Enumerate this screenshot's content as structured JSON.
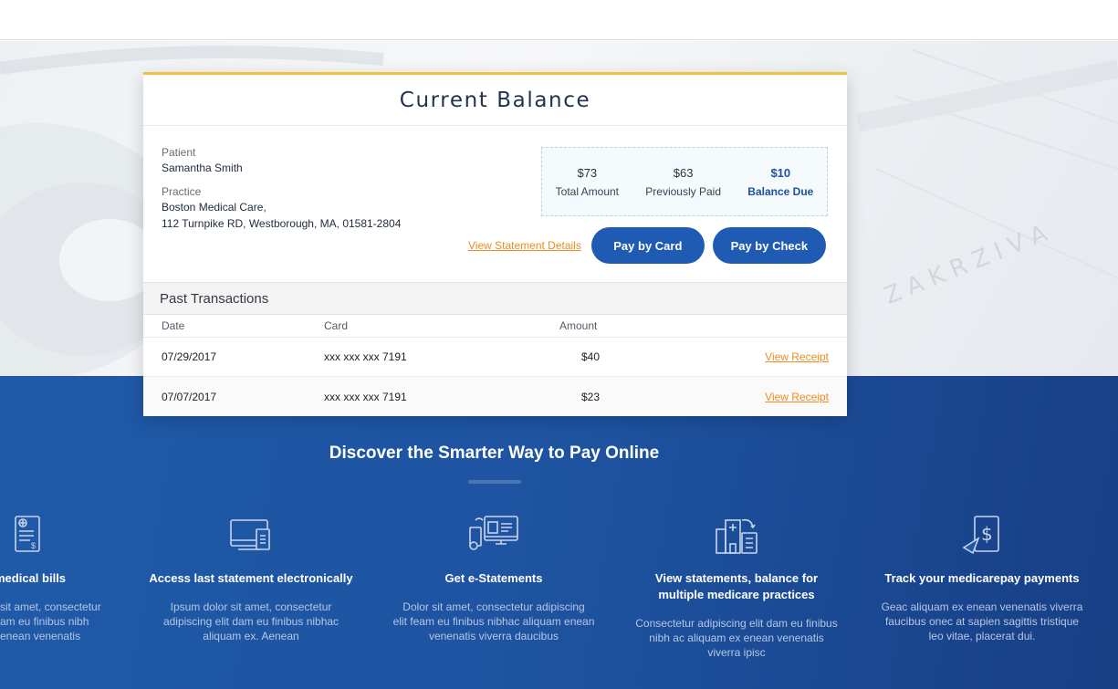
{
  "card": {
    "title": "Current Balance",
    "patient_label": "Patient",
    "patient_name": "Samantha Smith",
    "practice_label": "Practice",
    "practice_name": "Boston Medical Care,",
    "practice_address": "112 Turnpike RD, Westborough, MA, 01581-2804",
    "summary": {
      "total_amount": "$73",
      "total_label": "Total Amount",
      "previously_paid": "$63",
      "paid_label": "Previously Paid",
      "balance_due": "$10",
      "due_label": "Balance Due"
    },
    "view_statement_label": "View Statement Details",
    "pay_card_label": "Pay by Card",
    "pay_check_label": "Pay by Check"
  },
  "transactions": {
    "title": "Past Transactions",
    "headers": {
      "date": "Date",
      "card": "Card",
      "amount": "Amount"
    },
    "rows": [
      {
        "date": "07/29/2017",
        "card": "xxx xxx xxx 7191",
        "amount": "$40",
        "action": "View Receipt"
      },
      {
        "date": "07/07/2017",
        "card": "xxx xxx xxx 7191",
        "amount": "$23",
        "action": "View Receipt"
      }
    ]
  },
  "discover": {
    "title": "Discover the Smarter Way to Pay Online",
    "features": [
      {
        "icon": "medical-bill-icon",
        "title": "medical bills",
        "desc_1": "sit amet, consectetur",
        "desc_2": "am eu finibus nibh",
        "desc_3": "enean venenatis"
      },
      {
        "icon": "statement-device-icon",
        "title": "Access last statement electronically",
        "desc_1": "Ipsum dolor sit amet, consectetur",
        "desc_2": "adipiscing elit dam eu finibus nibhac",
        "desc_3": "aliquam ex. Aenean"
      },
      {
        "icon": "e-statement-computer-icon",
        "title": "Get e-Statements",
        "desc_1": "Dolor sit amet, consectetur adipiscing",
        "desc_2": "elit feam eu finibus nibhac aliquam enean",
        "desc_3": "venenatis viverra daucibus"
      },
      {
        "icon": "hospital-building-icon",
        "title_1": "View statements, balance for",
        "title_2": "multiple medicare practices",
        "desc_1": "Consectetur adipiscing elit dam eu finibus",
        "desc_2": "nibh ac aliquam ex enean venenatis",
        "desc_3": "viverra ipisc"
      },
      {
        "icon": "dollar-receipt-send-icon",
        "title": "Track your medicarepay payments",
        "desc_1": "Geac aliquam ex enean venenatis viverra",
        "desc_2": "faucibus onec at sapien sagittis tristique",
        "desc_3": "leo vitae, placerat dui."
      }
    ]
  },
  "colors": {
    "accent_blue": "#1f5ab3",
    "link_orange": "#ef8c1f",
    "card_top_border": "#f0c23c",
    "section_blue": "#1e53a0"
  }
}
